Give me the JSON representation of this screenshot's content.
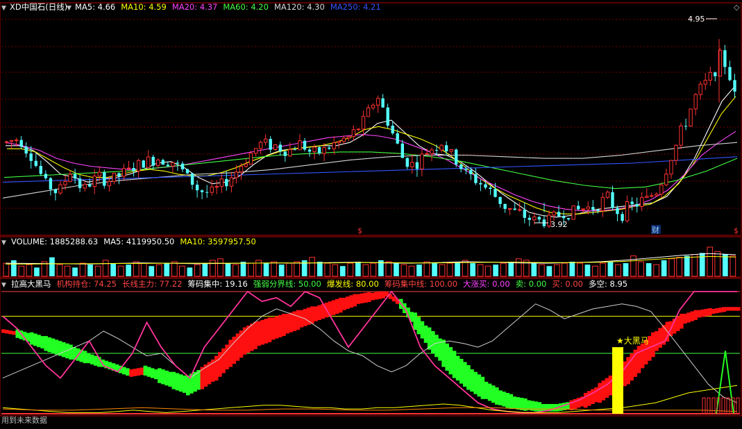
{
  "main_header": {
    "collapse": "▼",
    "title": "XD中国石(日线)",
    "ma": [
      {
        "label": "MA5: 4.66",
        "color": "#ffffff"
      },
      {
        "label": "MA10: 4.59",
        "color": "#ffff00"
      },
      {
        "label": "MA20: 4.37",
        "color": "#ff44ff"
      },
      {
        "label": "MA60: 4.20",
        "color": "#44ff44"
      },
      {
        "label": "MA120: 4.30",
        "color": "#d8d8d8"
      },
      {
        "label": "MA250: 4.21",
        "color": "#3355ff"
      }
    ],
    "high_label": "4.95",
    "low_label": "3.92",
    "markers": [
      "$",
      "$",
      "$"
    ],
    "cai_badge": "财",
    "pane_btn": "◇"
  },
  "volume_header": {
    "collapse": "▼",
    "items": [
      {
        "label": "VOLUME: 1885288.63",
        "color": "#ffffff"
      },
      {
        "label": "MA5: 4119950.50",
        "color": "#ffffff"
      },
      {
        "label": "MA10: 3597957.50",
        "color": "#ffff00"
      }
    ]
  },
  "indicator_header": {
    "collapse": "▼",
    "items": [
      {
        "label": "拉高大黑马",
        "color": "#ffffff"
      },
      {
        "label": "机构持仓: 74.25",
        "color": "#ff4444"
      },
      {
        "label": "长线主力: 77.22",
        "color": "#ff4444"
      },
      {
        "label": "筹码集中: 19.16",
        "color": "#ffffff"
      },
      {
        "label": "强弱分界线: 50.00",
        "color": "#44ff44"
      },
      {
        "label": "爆发线: 80.00",
        "color": "#ffff00"
      },
      {
        "label": "筹码集中线: 100.00",
        "color": "#ff4444"
      },
      {
        "label": "大涨买: 0.00",
        "color": "#ff44ff"
      },
      {
        "label": "卖: 0.00",
        "color": "#44ff44"
      },
      {
        "label": "买: 0.00",
        "color": "#ff4444"
      },
      {
        "label": "多空: 8.95",
        "color": "#ffffff"
      }
    ],
    "dark_horse_label": "★大黑马",
    "footer_note": "用到未来数据"
  },
  "colors": {
    "up": "#ff3232",
    "down": "#54ffff",
    "grid": "#7a0000",
    "panel_border": "#b00000"
  },
  "chart_data": [
    {
      "type": "candlestick",
      "ylim": [
        3.72,
        5.1
      ],
      "high": 4.95,
      "low": 3.92,
      "close_path": [
        4.3,
        4.33,
        4.2,
        4.05,
        3.98,
        4.12,
        4.0,
        4.08,
        4.06,
        4.1,
        4.14,
        4.18,
        4.2,
        4.18,
        4.1,
        4.0,
        3.98,
        4.04,
        4.12,
        4.22,
        4.3,
        4.28,
        4.24,
        4.3,
        4.22,
        4.26,
        4.3,
        4.34,
        4.44,
        4.6,
        4.4,
        4.2,
        4.15,
        4.25,
        4.3,
        4.2,
        4.1,
        4.05,
        3.98,
        3.9,
        3.85,
        3.82,
        3.8,
        3.84,
        3.86,
        3.88,
        3.9,
        3.95,
        3.85,
        3.9,
        3.94,
        4.0,
        4.2,
        4.4,
        4.6,
        4.7,
        4.85,
        4.62
      ],
      "series": [
        {
          "name": "MA5",
          "color": "#ffffff",
          "values": [
            4.28,
            4.28,
            4.25,
            4.18,
            4.1,
            4.08,
            4.05,
            4.07,
            4.08,
            4.1,
            4.13,
            4.17,
            4.18,
            4.14,
            4.08,
            4.04,
            4.05,
            4.09,
            4.16,
            4.22,
            4.25,
            4.26,
            4.27,
            4.28,
            4.28,
            4.3,
            4.35,
            4.42,
            4.44,
            4.36,
            4.28,
            4.23,
            4.22,
            4.18,
            4.12,
            4.05,
            3.98,
            3.92,
            3.86,
            3.84,
            3.83,
            3.84,
            3.86,
            3.88,
            3.89,
            3.9,
            3.91,
            3.92,
            3.96,
            4.06,
            4.2,
            4.38,
            4.56,
            4.66
          ]
        },
        {
          "name": "MA10",
          "color": "#ffff00",
          "values": [
            4.26,
            4.26,
            4.24,
            4.19,
            4.14,
            4.1,
            4.08,
            4.08,
            4.1,
            4.12,
            4.13,
            4.12,
            4.1,
            4.09,
            4.09,
            4.11,
            4.14,
            4.18,
            4.21,
            4.24,
            4.26,
            4.27,
            4.28,
            4.3,
            4.33,
            4.38,
            4.4,
            4.38,
            4.35,
            4.32,
            4.28,
            4.22,
            4.15,
            4.08,
            4.02,
            3.97,
            3.93,
            3.89,
            3.86,
            3.85,
            3.85,
            3.86,
            3.87,
            3.88,
            3.9,
            3.91,
            3.96,
            4.04,
            4.16,
            4.32,
            4.48,
            4.59
          ]
        },
        {
          "name": "MA20",
          "color": "#ff44ff",
          "values": [
            4.3,
            4.28,
            4.25,
            4.2,
            4.17,
            4.15,
            4.14,
            4.13,
            4.13,
            4.14,
            4.15,
            4.17,
            4.19,
            4.21,
            4.23,
            4.25,
            4.27,
            4.29,
            4.31,
            4.33,
            4.34,
            4.35,
            4.34,
            4.32,
            4.28,
            4.24,
            4.19,
            4.13,
            4.07,
            4.02,
            3.97,
            3.93,
            3.9,
            3.88,
            3.87,
            3.87,
            3.88,
            3.9,
            3.94,
            4.0,
            4.1,
            4.22,
            4.3,
            4.37
          ]
        },
        {
          "name": "MA60",
          "color": "#44ff44",
          "values": [
            4.08,
            4.09,
            4.1,
            4.11,
            4.12,
            4.14,
            4.16,
            4.18,
            4.2,
            4.22,
            4.23,
            4.24,
            4.24,
            4.23,
            4.21,
            4.18,
            4.14,
            4.1,
            4.06,
            4.03,
            4.01,
            4.02,
            4.06,
            4.12,
            4.2
          ]
        },
        {
          "name": "MA120",
          "color": "#d8d8d8",
          "values": [
            3.95,
            3.99,
            4.03,
            4.06,
            4.08,
            4.1,
            4.11,
            4.13,
            4.16,
            4.19,
            4.21,
            4.22,
            4.22,
            4.21,
            4.2,
            4.2,
            4.22,
            4.25,
            4.28,
            4.3
          ]
        },
        {
          "name": "MA250",
          "color": "#3355ff",
          "values": [
            4.05,
            4.06,
            4.07,
            4.08,
            4.09,
            4.1,
            4.11,
            4.12,
            4.13,
            4.14,
            4.15,
            4.16,
            4.17,
            4.19,
            4.21
          ]
        }
      ]
    },
    {
      "type": "bar",
      "name": "VOLUME",
      "ylim": [
        0,
        1
      ],
      "values": [
        0.45,
        0.55,
        0.35,
        0.4,
        0.3,
        0.5,
        0.65,
        0.4,
        0.35,
        0.3,
        0.45,
        0.4,
        0.35,
        0.55,
        0.45,
        0.35,
        0.4,
        0.5,
        0.45,
        0.35,
        0.4,
        0.45,
        0.5,
        0.35,
        0.3,
        0.4,
        0.45,
        0.55,
        0.6,
        0.45,
        0.4,
        0.5,
        0.45,
        0.55,
        0.45,
        0.5,
        0.4,
        0.45,
        0.5,
        0.55,
        0.65,
        0.5,
        0.45,
        0.4,
        0.35,
        0.45,
        0.5,
        0.4,
        0.45,
        0.55,
        0.5,
        0.45,
        0.4,
        0.35,
        0.4,
        0.5,
        0.45,
        0.4,
        0.45,
        0.5,
        0.55,
        0.45,
        0.4,
        0.35,
        0.4,
        0.45,
        0.5,
        0.6,
        0.55,
        0.45,
        0.4,
        0.35,
        0.4,
        0.45,
        0.5,
        0.45,
        0.4,
        0.35,
        0.45,
        0.5,
        0.4,
        0.45,
        0.7,
        0.5,
        0.45,
        0.4,
        0.55,
        0.6,
        0.65,
        0.7,
        0.75,
        0.8,
        1.0,
        0.85,
        0.75,
        0.7
      ],
      "ma5": [
        0.45,
        0.44,
        0.43,
        0.42,
        0.44,
        0.46,
        0.45,
        0.43,
        0.44,
        0.45,
        0.46,
        0.45,
        0.47,
        0.48,
        0.46,
        0.45,
        0.47,
        0.5,
        0.48,
        0.46,
        0.45,
        0.47,
        0.5,
        0.56,
        0.64,
        0.72,
        0.78,
        0.74
      ],
      "ma10": [
        0.42,
        0.42,
        0.43,
        0.43,
        0.44,
        0.44,
        0.45,
        0.45,
        0.45,
        0.45,
        0.46,
        0.46,
        0.46,
        0.47,
        0.47,
        0.46,
        0.46,
        0.47,
        0.48,
        0.48,
        0.47,
        0.47,
        0.48,
        0.52,
        0.58,
        0.64,
        0.68,
        0.66
      ]
    },
    {
      "type": "area",
      "name": "拉高大黑马",
      "ylim": [
        0,
        100
      ],
      "reference_lines": [
        {
          "label": "筹码集中线",
          "value": 100,
          "color": "#ff4444"
        },
        {
          "label": "爆发线",
          "value": 80,
          "color": "#ffff00"
        },
        {
          "label": "强弱分界线",
          "value": 50,
          "color": "#44ff44"
        }
      ],
      "band_centre": [
        68,
        66,
        62,
        58,
        54,
        50,
        46,
        42,
        38,
        34,
        36,
        32,
        28,
        24,
        30,
        38,
        50,
        60,
        66,
        70,
        74,
        78,
        82,
        86,
        90,
        94,
        96,
        98,
        90,
        76,
        62,
        50,
        38,
        28,
        20,
        14,
        10,
        8,
        6,
        6,
        8,
        12,
        18,
        26,
        36,
        48,
        60,
        70,
        78,
        82,
        84,
        86
      ],
      "band_width": [
        3,
        7,
        10,
        12,
        12,
        10,
        8,
        6,
        6,
        6,
        8,
        12,
        14,
        16,
        18,
        20,
        22,
        22,
        20,
        18,
        16,
        14,
        12,
        12,
        10,
        8,
        6,
        4,
        8,
        14,
        18,
        22,
        20,
        18,
        14,
        12,
        10,
        8,
        6,
        6,
        8,
        12,
        16,
        20,
        22,
        20,
        16,
        12,
        8,
        6,
        4,
        3
      ],
      "band_up": [
        true,
        false,
        false,
        false,
        false,
        false,
        false,
        false,
        false,
        true,
        false,
        false,
        false,
        false,
        true,
        true,
        true,
        true,
        true,
        true,
        true,
        true,
        true,
        true,
        true,
        true,
        true,
        true,
        false,
        false,
        false,
        false,
        false,
        false,
        false,
        false,
        false,
        false,
        false,
        false,
        true,
        true,
        true,
        true,
        true,
        true,
        true,
        true,
        true,
        true,
        true,
        true
      ],
      "pink_series": [
        80,
        70,
        55,
        40,
        30,
        45,
        60,
        40,
        35,
        50,
        75,
        55,
        40,
        30,
        55,
        70,
        85,
        100,
        92,
        95,
        88,
        100,
        95,
        75,
        55,
        70,
        85,
        100,
        85,
        55,
        40,
        30,
        20,
        10,
        5,
        3,
        2,
        2,
        4,
        8,
        12,
        18,
        25,
        35,
        50,
        55,
        60,
        85,
        100,
        120,
        130,
        125
      ],
      "white_series": [
        30,
        35,
        40,
        45,
        50,
        55,
        60,
        68,
        62,
        55,
        48,
        50,
        40,
        30,
        38,
        45,
        58,
        70,
        80,
        86,
        82,
        78,
        70,
        60,
        52,
        48,
        40,
        35,
        40,
        50,
        58,
        60,
        58,
        55,
        60,
        70,
        80,
        90,
        85,
        78,
        82,
        86,
        88,
        90,
        88,
        84,
        70,
        55,
        40,
        25,
        15,
        10
      ],
      "yellow_series": [
        6,
        5,
        4,
        3,
        2,
        2,
        2,
        3,
        4,
        3,
        2,
        3,
        4,
        5,
        6,
        7,
        8,
        8,
        7,
        6,
        6,
        5,
        5,
        6,
        6,
        7,
        8,
        9,
        8,
        6,
        4,
        3,
        2,
        2,
        2,
        3,
        4,
        5,
        6,
        8,
        10,
        14,
        18,
        20,
        22,
        24
      ],
      "dark_horse_signal": 55,
      "green_spike": 52,
      "red_bars": [
        14,
        14,
        14,
        14,
        14,
        14,
        14,
        14
      ],
      "footer_orange": [
        5,
        4,
        4,
        5,
        6,
        5,
        4,
        4,
        5,
        5,
        4,
        4,
        5,
        6,
        6,
        5,
        5,
        4,
        4,
        4,
        4,
        3
      ]
    }
  ]
}
